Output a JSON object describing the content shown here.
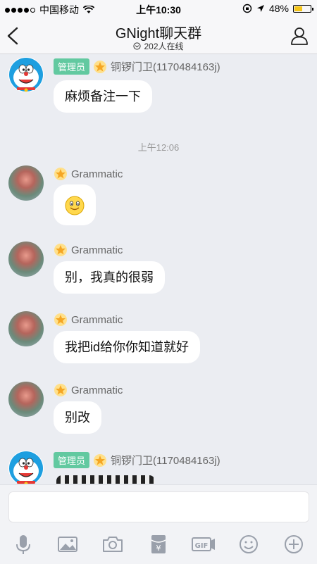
{
  "status": {
    "carrier": "中国移动",
    "time": "上午10:30",
    "battery": "48%",
    "battery_level": 0.48
  },
  "nav": {
    "title": "GNight聊天群",
    "online": "202人在线"
  },
  "messages": [
    {
      "sender": "铜锣门卫(1170484163j)",
      "role": "管理员",
      "text": "麻烦备注一下"
    },
    {
      "sender": "Grammatic",
      "text": "🙂"
    },
    {
      "sender": "Grammatic",
      "text": "别，我真的很弱"
    },
    {
      "sender": "Grammatic",
      "text": "我把id给你你知道就好"
    },
    {
      "sender": "Grammatic",
      "text": "别改"
    },
    {
      "sender": "铜锣门卫(1170484163j)",
      "role": "管理员",
      "text": ""
    }
  ],
  "timestamp": "上午12:06",
  "input": {
    "placeholder": ""
  },
  "toolbar": [
    "microphone-icon",
    "image-icon",
    "camera-icon",
    "red-packet-icon",
    "gif-icon",
    "emoji-icon",
    "plus-icon"
  ]
}
